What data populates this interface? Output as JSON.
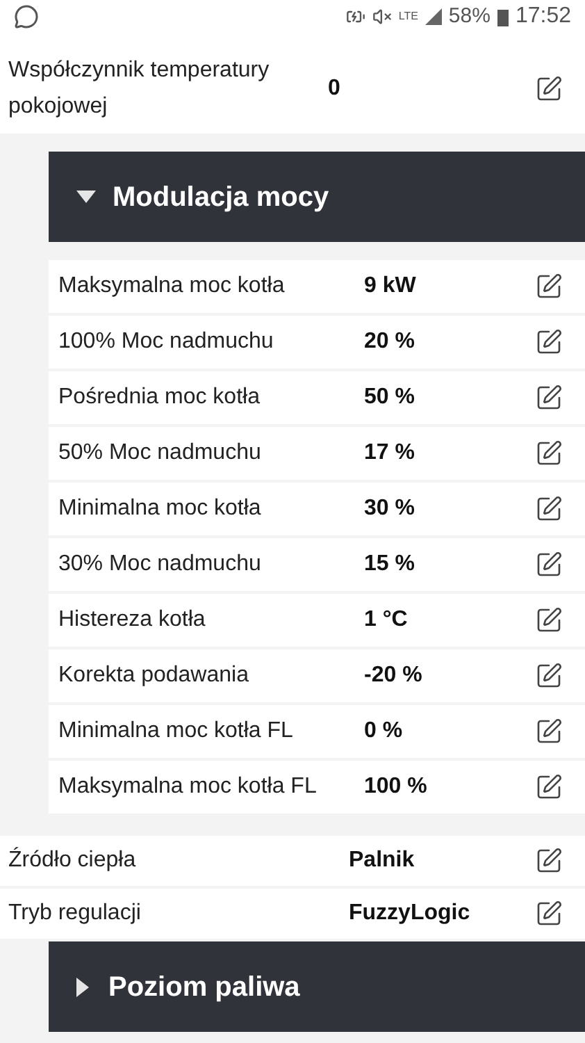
{
  "status_bar": {
    "network": "LTE",
    "battery": "58%",
    "time": "17:52"
  },
  "items": [
    {
      "kind": "row",
      "label": "Współczynnik temperatury pokojowej",
      "value": "0"
    },
    {
      "kind": "section",
      "title": "Modulacja mocy",
      "expanded": true,
      "children": [
        {
          "label": "Maksymalna moc kotła",
          "value": "9 kW"
        },
        {
          "label": "100% Moc nadmuchu",
          "value": "20 %"
        },
        {
          "label": "Pośrednia moc kotła",
          "value": "50 %"
        },
        {
          "label": "50% Moc nadmuchu",
          "value": "17 %"
        },
        {
          "label": "Minimalna moc kotła",
          "value": "30 %"
        },
        {
          "label": "30% Moc nadmuchu",
          "value": "15 %"
        },
        {
          "label": "Histereza kotła",
          "value": "1 °C"
        },
        {
          "label": "Korekta podawania",
          "value": "-20 %"
        },
        {
          "label": "Minimalna moc kotła FL",
          "value": "0 %"
        },
        {
          "label": "Maksymalna moc kotła FL",
          "value": "100 %"
        }
      ]
    },
    {
      "kind": "row",
      "label": "Źródło ciepła",
      "value": "Palnik"
    },
    {
      "kind": "row",
      "label": "Tryb regulacji",
      "value": "FuzzyLogic"
    },
    {
      "kind": "section",
      "title": "Poziom paliwa",
      "expanded": false
    }
  ]
}
